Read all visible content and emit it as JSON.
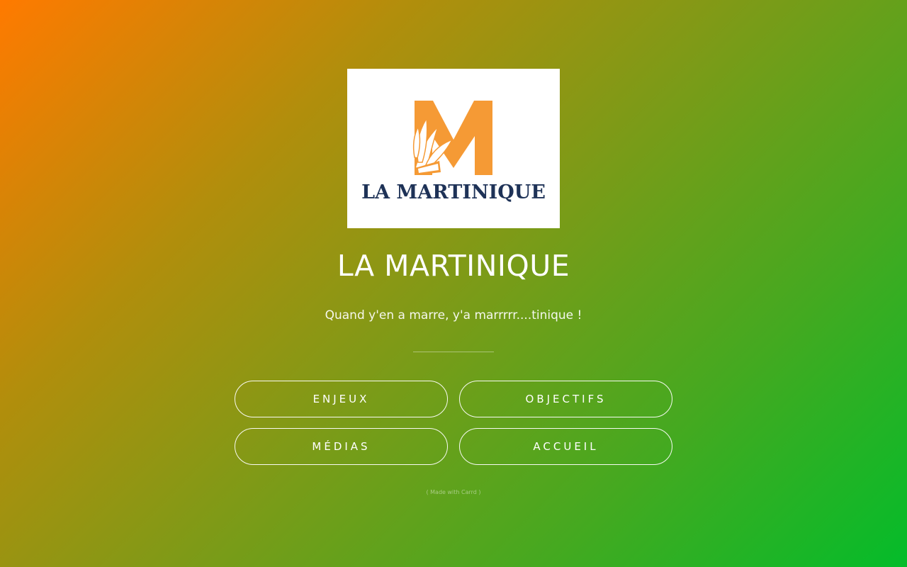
{
  "logo": {
    "text": "LA MARTINIQUE",
    "letter": "M",
    "letter_color": "#f59a35",
    "text_color": "#1e3257"
  },
  "header": {
    "title": "LA MARTINIQUE",
    "subtitle": "Quand y'en a marre, y'a marrrrr....tinique !"
  },
  "nav": {
    "buttons": [
      {
        "label": "ENJEUX"
      },
      {
        "label": "OBJECTIFS"
      },
      {
        "label": "MÉDIAS"
      },
      {
        "label": "ACCUEIL"
      }
    ]
  },
  "footer": {
    "credit": "( Made with Carrd )"
  },
  "colors": {
    "gradient_start": "#ff7a00",
    "gradient_end": "#04bc2a"
  }
}
